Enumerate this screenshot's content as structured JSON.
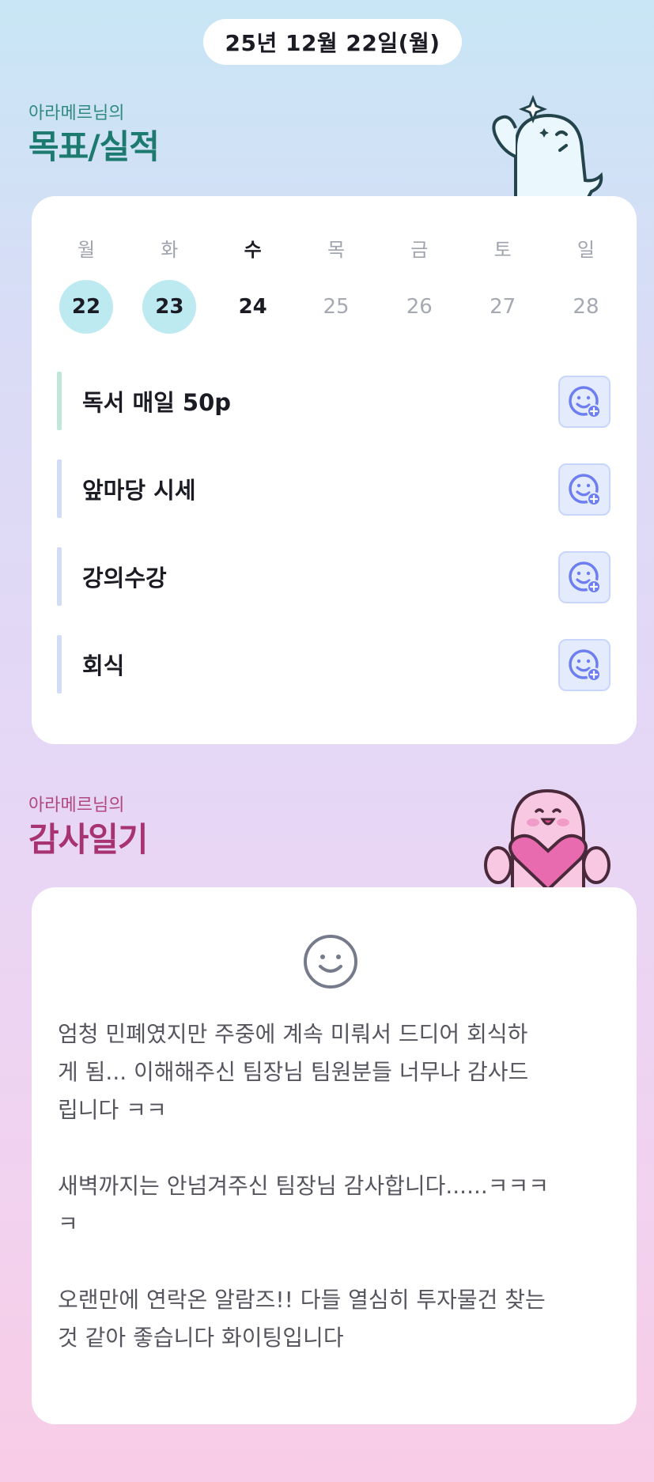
{
  "header": {
    "date": "25년 12월 22일(월)"
  },
  "goals_section": {
    "subtitle": "아라메르님의",
    "title": "목표/실적"
  },
  "week": {
    "days": [
      {
        "dow": "월",
        "date": "22",
        "state": "done"
      },
      {
        "dow": "화",
        "date": "23",
        "state": "done"
      },
      {
        "dow": "수",
        "date": "24",
        "state": "today"
      },
      {
        "dow": "목",
        "date": "25",
        "state": "upcoming"
      },
      {
        "dow": "금",
        "date": "26",
        "state": "upcoming"
      },
      {
        "dow": "토",
        "date": "27",
        "state": "upcoming"
      },
      {
        "dow": "일",
        "date": "28",
        "state": "upcoming"
      }
    ]
  },
  "goals": [
    {
      "label": "독서 매일 50p",
      "accent": "#bfe8d8"
    },
    {
      "label": "앞마당 시세",
      "accent": "#d3dcf5"
    },
    {
      "label": "강의수강",
      "accent": "#d3dcf5"
    },
    {
      "label": "회식",
      "accent": "#d3dcf5"
    }
  ],
  "icons": {
    "goal_action": "smiley-add-icon",
    "diary_mood": "smiley-face-icon",
    "goal_mascot": "ghost-mascot",
    "thanks_mascot": "pink-heart-mascot"
  },
  "thanks_section": {
    "subtitle": "아라메르님의",
    "title": "감사일기"
  },
  "diary": {
    "paragraphs": [
      "엄청 민폐였지만 주중에 계속 미뤄서 드디어 회식하\n게 됨... 이해해주신 팀장님 팀원분들 너무나 감사드\n립니다 ㅋㅋ",
      "새벽까지는 안넘겨주신 팀장님 감사합니다......ㅋㅋㅋ\nㅋ",
      "오랜만에 연락온 알람즈!! 다들 열심히 투자물건 찾는\n것 같아 좋습니다 화이팅입니다"
    ]
  },
  "colors": {
    "goal_title": "#1d7a70",
    "thanks_title": "#a83373",
    "done_date": "#bdeaf1",
    "icon_blue": "#6d7ff0"
  }
}
